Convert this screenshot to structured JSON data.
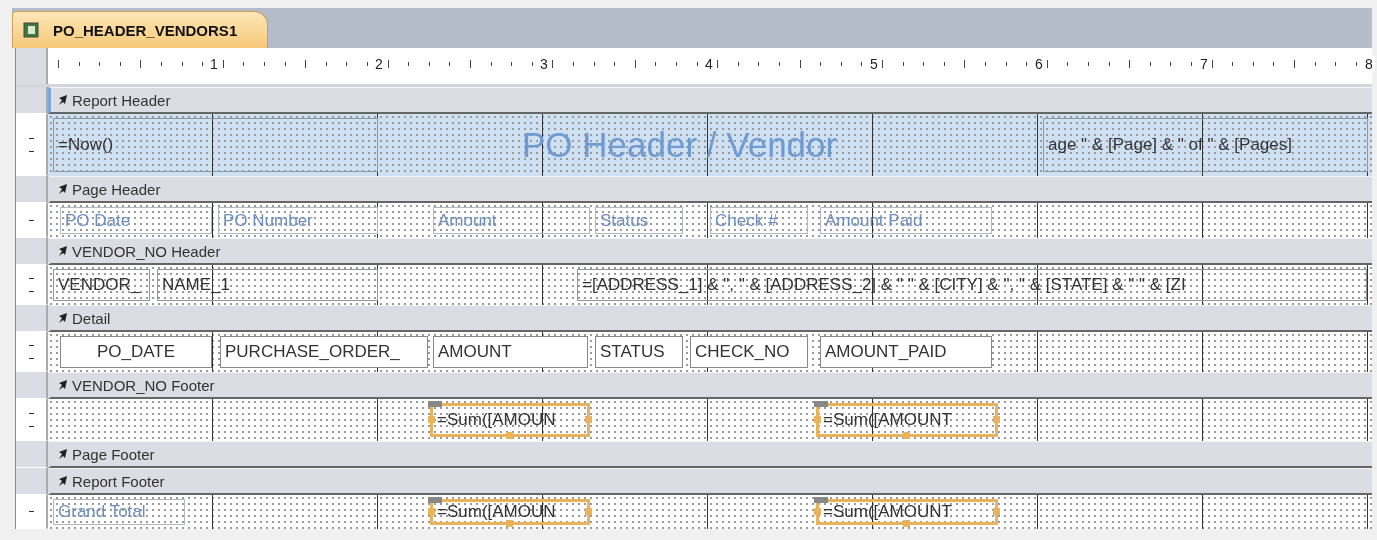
{
  "tab": {
    "title": "PO_HEADER_VENDORS1",
    "selected": true
  },
  "ruler": [
    "1",
    "2",
    "3",
    "4",
    "5",
    "6",
    "7",
    "8"
  ],
  "sections": [
    {
      "title": "Report Header",
      "selected": true,
      "controls": [
        {
          "kind": "textbox",
          "text": "=Now()",
          "selected": false
        },
        {
          "kind": "title",
          "text": "PO Header / Vendor",
          "selected": false
        },
        {
          "kind": "textbox",
          "text": "age \" & [Page] & \" of \" & [Pages]",
          "selected": false
        }
      ]
    },
    {
      "title": "Page Header",
      "selected": false,
      "controls": [
        {
          "kind": "label",
          "text": "PO Date",
          "selected": false
        },
        {
          "kind": "label",
          "text": "PO Number",
          "selected": false
        },
        {
          "kind": "label",
          "text": "Amount",
          "selected": false
        },
        {
          "kind": "label",
          "text": "Status",
          "selected": false
        },
        {
          "kind": "label",
          "text": "Check #",
          "selected": false
        },
        {
          "kind": "label",
          "text": "Amount Paid",
          "selected": false
        }
      ]
    },
    {
      "title": "VENDOR_NO Header",
      "selected": false,
      "controls": [
        {
          "kind": "textbox",
          "text": "VENDOR_",
          "selected": false
        },
        {
          "kind": "textbox",
          "text": "NAME_1",
          "selected": false
        },
        {
          "kind": "textbox",
          "text": "=[ADDRESS_1] & \", \" & [ADDRESS_2] & \" \" & [CITY] & \", \" & [STATE] & \" \" & [ZI",
          "selected": false
        }
      ]
    },
    {
      "title": "Detail",
      "selected": false,
      "controls": [
        {
          "kind": "field",
          "text": "PO_DATE",
          "selected": false
        },
        {
          "kind": "field",
          "text": "PURCHASE_ORDER_",
          "selected": false
        },
        {
          "kind": "field",
          "text": "AMOUNT",
          "selected": false
        },
        {
          "kind": "field",
          "text": "STATUS",
          "selected": false
        },
        {
          "kind": "field",
          "text": "CHECK_NO",
          "selected": false
        },
        {
          "kind": "field",
          "text": "AMOUNT_PAID",
          "selected": false
        }
      ]
    },
    {
      "title": "VENDOR_NO Footer",
      "selected": false,
      "controls": [
        {
          "kind": "textbox",
          "text": "=Sum([AMOUN",
          "selected": true
        },
        {
          "kind": "textbox",
          "text": "=Sum([AMOUNT",
          "selected": true
        }
      ]
    },
    {
      "title": "Page Footer",
      "selected": false
    },
    {
      "title": "Report Footer",
      "selected": false,
      "controls": [
        {
          "kind": "label",
          "text": "Grand Total",
          "selected": false
        },
        {
          "kind": "textbox",
          "text": "=Sum([AMOUN",
          "selected": true
        },
        {
          "kind": "textbox",
          "text": "=Sum([AMOUNT",
          "selected": true
        }
      ]
    }
  ]
}
